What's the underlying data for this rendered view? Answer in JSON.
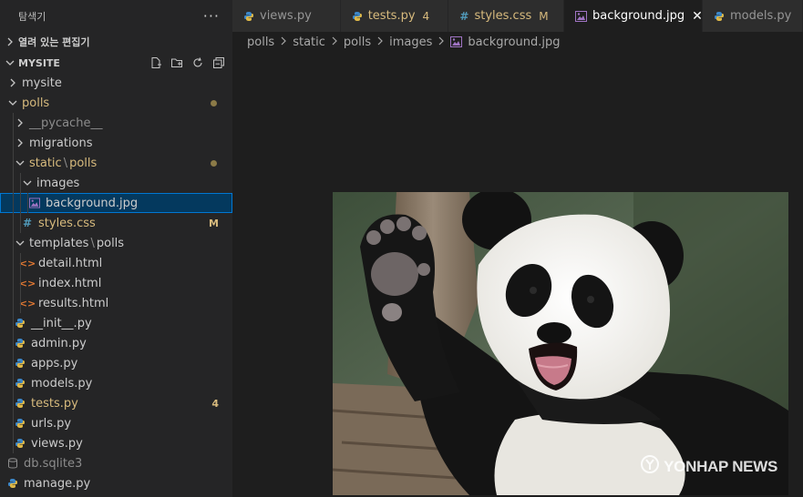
{
  "sidebar": {
    "title": "탐색기",
    "more": "···",
    "open_editors": "열려 있는 편집기",
    "workspace": "MYSITE",
    "tree": [
      {
        "label": "mysite",
        "type": "folder",
        "open": false,
        "indent": 0
      },
      {
        "label": "polls",
        "type": "folder",
        "open": true,
        "indent": 0,
        "color": "yellow",
        "dot": true
      },
      {
        "label": "__pycache__",
        "type": "folder",
        "open": false,
        "indent": 1,
        "color": "muted"
      },
      {
        "label": "migrations",
        "type": "folder",
        "open": false,
        "indent": 1
      },
      {
        "label": "static",
        "label2": "polls",
        "type": "folder",
        "open": true,
        "indent": 1,
        "color": "yellow",
        "dot": true
      },
      {
        "label": "images",
        "type": "folder",
        "open": true,
        "indent": 2
      },
      {
        "label": "background.jpg",
        "type": "image",
        "indent": 3,
        "selected": true
      },
      {
        "label": "styles.css",
        "type": "css",
        "indent": 2,
        "color": "yellow",
        "badge": "M"
      },
      {
        "label": "templates",
        "label2": "polls",
        "type": "folder",
        "open": true,
        "indent": 1
      },
      {
        "label": "detail.html",
        "type": "html",
        "indent": 2
      },
      {
        "label": "index.html",
        "type": "html",
        "indent": 2
      },
      {
        "label": "results.html",
        "type": "html",
        "indent": 2
      },
      {
        "label": "__init__.py",
        "type": "py",
        "indent": 1
      },
      {
        "label": "admin.py",
        "type": "py",
        "indent": 1
      },
      {
        "label": "apps.py",
        "type": "py",
        "indent": 1
      },
      {
        "label": "models.py",
        "type": "py",
        "indent": 1
      },
      {
        "label": "tests.py",
        "type": "py",
        "indent": 1,
        "color": "yellow",
        "badge": "4"
      },
      {
        "label": "urls.py",
        "type": "py",
        "indent": 1
      },
      {
        "label": "views.py",
        "type": "py",
        "indent": 1
      },
      {
        "label": "db.sqlite3",
        "type": "db",
        "indent": 0,
        "color": "muted"
      },
      {
        "label": "manage.py",
        "type": "py",
        "indent": 0
      }
    ]
  },
  "tabs": [
    {
      "label": "views.py",
      "type": "py"
    },
    {
      "label": "tests.py",
      "type": "py",
      "badge": "4",
      "color": "yellow"
    },
    {
      "label": "styles.css",
      "type": "css",
      "badge": "M",
      "color": "yellow"
    },
    {
      "label": "background.jpg",
      "type": "image",
      "active": true,
      "close": "✕"
    },
    {
      "label": "models.py",
      "type": "py"
    }
  ],
  "breadcrumb": [
    "polls",
    "static",
    "polls",
    "images",
    "background.jpg"
  ],
  "image": {
    "watermark": "YONHAP NEWS"
  },
  "colors": {
    "accent": "#0078d4",
    "modified": "#d7ba7d",
    "html_icon": "#e37933",
    "css_icon": "#519aba",
    "py_icon": "#3c87c8",
    "image_icon": "#a074c4"
  }
}
